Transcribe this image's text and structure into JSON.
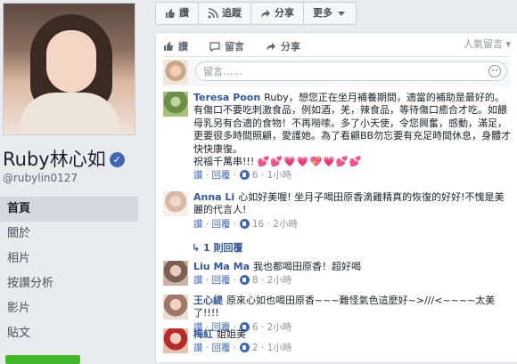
{
  "profile": {
    "name": "Ruby林心如",
    "verified_mark": "✓",
    "handle": "@rubylin0127"
  },
  "nav": {
    "items": [
      {
        "label": "首頁",
        "active": true
      },
      {
        "label": "關於"
      },
      {
        "label": "相片"
      },
      {
        "label": "按讚分析"
      },
      {
        "label": "影片"
      },
      {
        "label": "貼文"
      }
    ]
  },
  "top_actions": {
    "like": "讚",
    "follow": "追蹤",
    "share": "分享",
    "more": "更多"
  },
  "post_actions": {
    "like": "讚",
    "comment": "留言",
    "share": "分享",
    "sort": "人氣留言"
  },
  "compose": {
    "placeholder": "留言……"
  },
  "comments": [
    {
      "author": "Teresa Poon",
      "text": "Ruby，想您正在坐月補養期間，適當的補助是最好的。有傷口不要吃刺激食品，例如酒，羌，辣食品，等待傷口癒合才吃。如餵母乳另有合適的食物！不再嘮嗦。多了小天使，令您興奮，感動，滿足，更要很多時間照顧，愛護她。為了看顧BB勿忘要有充足時間休息，身體才快快康復。",
      "tail": "祝福千萬串!!!",
      "hearts": "💕💕💗💗💖💗💕💕",
      "like_label": "讚",
      "reply_label": "回覆",
      "likes": "6",
      "time": "1小時"
    },
    {
      "author": "Anna Li",
      "text": "心如好美喔! 坐月子喝田原香滴雞精真的恢復的好好!不愧是美麗的代言人!",
      "like_label": "讚",
      "reply_label": "回覆",
      "likes": "16",
      "time": "2小時",
      "replies_link": "1 則回覆"
    },
    {
      "author": "Liu Ma Ma",
      "text": "我也都喝田原香！超好喝",
      "like_label": "讚",
      "reply_label": "回覆",
      "likes": "8",
      "time": "2小時"
    },
    {
      "author": "王心緹",
      "text": "原來心如也喝田原香~~~難怪氣色這麼好~>///<~~~~太美了!!!!",
      "like_label": "讚",
      "reply_label": "回覆",
      "likes": "6",
      "time": "2小時"
    },
    {
      "author": "梅紅",
      "text": "姐姐美",
      "like_label": "讚",
      "reply_label": "回覆",
      "likes": "2",
      "time": "1小時"
    }
  ]
}
